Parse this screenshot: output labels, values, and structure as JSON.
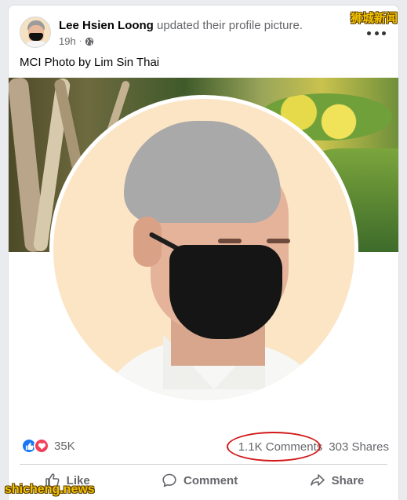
{
  "post": {
    "author": "Lee Hsien Loong",
    "action_text": "updated their profile picture.",
    "time": "19h",
    "caption": "MCI Photo by Lim Sin Thai",
    "icons": {
      "privacy": "globe-icon",
      "more": "more-options-icon"
    }
  },
  "stats": {
    "reaction_icons": [
      "like-icon",
      "love-icon"
    ],
    "reaction_count": "35K",
    "comments": "1.1K Comments",
    "shares": "303 Shares",
    "highlight_color": "#d21818"
  },
  "actions": {
    "like": "Like",
    "comment": "Comment",
    "share": "Share"
  },
  "watermarks": {
    "top": "狮城新闻",
    "bottom": "shicheng.news"
  },
  "colors": {
    "like_blue": "#1877f2",
    "love_red": "#f33e58",
    "watermark_yellow": "#f2c200"
  }
}
